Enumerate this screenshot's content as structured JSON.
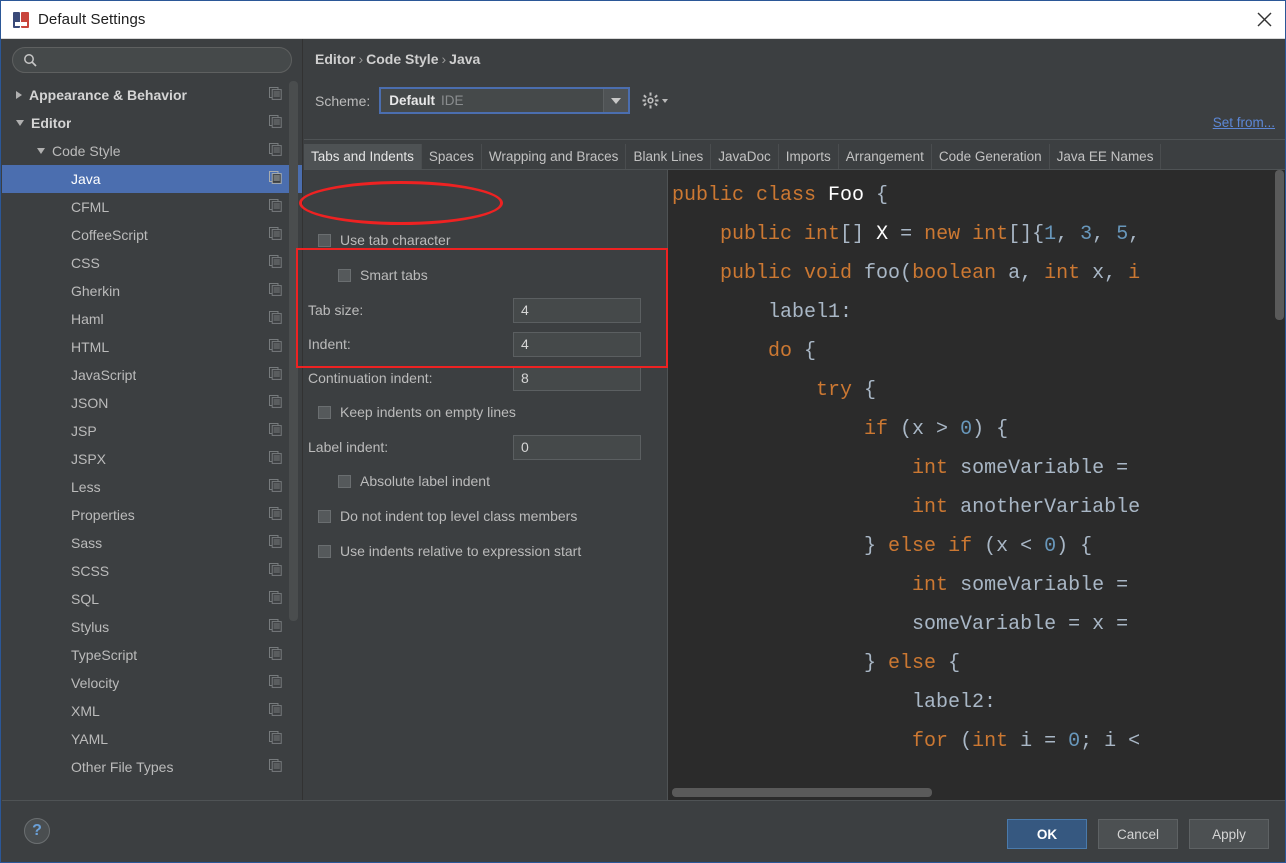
{
  "window": {
    "title": "Default Settings",
    "app_icon": "intellij-idea-icon",
    "close_label": "✕"
  },
  "sidebar": {
    "search": {
      "value": "",
      "placeholder": "",
      "icon": "search-icon"
    },
    "items": [
      {
        "label": "Appearance & Behavior",
        "indent": 0,
        "arrow": "right",
        "bold": true,
        "selected": false,
        "copy_icon": true
      },
      {
        "label": "Editor",
        "indent": 0,
        "arrow": "down",
        "bold": true,
        "selected": false,
        "copy_icon": true
      },
      {
        "label": "Code Style",
        "indent": 1,
        "arrow": "down",
        "bold": false,
        "selected": false,
        "copy_icon": true
      },
      {
        "label": "Java",
        "indent": 2,
        "arrow": "none",
        "bold": false,
        "selected": true,
        "copy_icon": true
      },
      {
        "label": "CFML",
        "indent": 2,
        "arrow": "none",
        "bold": false,
        "selected": false,
        "copy_icon": true
      },
      {
        "label": "CoffeeScript",
        "indent": 2,
        "arrow": "none",
        "bold": false,
        "selected": false,
        "copy_icon": true
      },
      {
        "label": "CSS",
        "indent": 2,
        "arrow": "none",
        "bold": false,
        "selected": false,
        "copy_icon": true
      },
      {
        "label": "Gherkin",
        "indent": 2,
        "arrow": "none",
        "bold": false,
        "selected": false,
        "copy_icon": true
      },
      {
        "label": "Haml",
        "indent": 2,
        "arrow": "none",
        "bold": false,
        "selected": false,
        "copy_icon": true
      },
      {
        "label": "HTML",
        "indent": 2,
        "arrow": "none",
        "bold": false,
        "selected": false,
        "copy_icon": true
      },
      {
        "label": "JavaScript",
        "indent": 2,
        "arrow": "none",
        "bold": false,
        "selected": false,
        "copy_icon": true
      },
      {
        "label": "JSON",
        "indent": 2,
        "arrow": "none",
        "bold": false,
        "selected": false,
        "copy_icon": true
      },
      {
        "label": "JSP",
        "indent": 2,
        "arrow": "none",
        "bold": false,
        "selected": false,
        "copy_icon": true
      },
      {
        "label": "JSPX",
        "indent": 2,
        "arrow": "none",
        "bold": false,
        "selected": false,
        "copy_icon": true
      },
      {
        "label": "Less",
        "indent": 2,
        "arrow": "none",
        "bold": false,
        "selected": false,
        "copy_icon": true
      },
      {
        "label": "Properties",
        "indent": 2,
        "arrow": "none",
        "bold": false,
        "selected": false,
        "copy_icon": true
      },
      {
        "label": "Sass",
        "indent": 2,
        "arrow": "none",
        "bold": false,
        "selected": false,
        "copy_icon": true
      },
      {
        "label": "SCSS",
        "indent": 2,
        "arrow": "none",
        "bold": false,
        "selected": false,
        "copy_icon": true
      },
      {
        "label": "SQL",
        "indent": 2,
        "arrow": "none",
        "bold": false,
        "selected": false,
        "copy_icon": true
      },
      {
        "label": "Stylus",
        "indent": 2,
        "arrow": "none",
        "bold": false,
        "selected": false,
        "copy_icon": true
      },
      {
        "label": "TypeScript",
        "indent": 2,
        "arrow": "none",
        "bold": false,
        "selected": false,
        "copy_icon": true
      },
      {
        "label": "Velocity",
        "indent": 2,
        "arrow": "none",
        "bold": false,
        "selected": false,
        "copy_icon": true
      },
      {
        "label": "XML",
        "indent": 2,
        "arrow": "none",
        "bold": false,
        "selected": false,
        "copy_icon": true
      },
      {
        "label": "YAML",
        "indent": 2,
        "arrow": "none",
        "bold": false,
        "selected": false,
        "copy_icon": true
      },
      {
        "label": "Other File Types",
        "indent": 2,
        "arrow": "none",
        "bold": false,
        "selected": false,
        "copy_icon": true
      }
    ]
  },
  "content": {
    "breadcrumb": {
      "parts": [
        "Editor",
        "Code Style",
        "Java"
      ],
      "separator": "›"
    },
    "scheme": {
      "label": "Scheme:",
      "value": "Default",
      "value_suffix": "IDE",
      "gear_icon": "gear-icon",
      "dropdown_icon": "chevron-down-icon"
    },
    "set_from_link": "Set from...",
    "tabs": [
      {
        "label": "Tabs and Indents",
        "active": true
      },
      {
        "label": "Spaces",
        "active": false
      },
      {
        "label": "Wrapping and Braces",
        "active": false
      },
      {
        "label": "Blank Lines",
        "active": false
      },
      {
        "label": "JavaDoc",
        "active": false
      },
      {
        "label": "Imports",
        "active": false
      },
      {
        "label": "Arrangement",
        "active": false
      },
      {
        "label": "Code Generation",
        "active": false
      },
      {
        "label": "Java EE Names",
        "active": false
      }
    ]
  },
  "settings": {
    "use_tab_character": {
      "label": "Use tab character",
      "checked": false
    },
    "smart_tabs": {
      "label": "Smart tabs",
      "checked": false
    },
    "tab_size": {
      "label": "Tab size:",
      "value": "4"
    },
    "indent": {
      "label": "Indent:",
      "value": "4"
    },
    "continuation_indent": {
      "label": "Continuation indent:",
      "value": "8"
    },
    "keep_indents_on_empty_lines": {
      "label": "Keep indents on empty lines",
      "checked": false
    },
    "label_indent": {
      "label": "Label indent:",
      "value": "0"
    },
    "absolute_label_indent": {
      "label": "Absolute label indent",
      "checked": false
    },
    "do_not_indent_top_level": {
      "label": "Do not indent top level class members",
      "checked": false
    },
    "use_indents_relative": {
      "label": "Use indents relative to expression start",
      "checked": false
    }
  },
  "preview": {
    "lines": [
      [
        [
          "k",
          "public "
        ],
        [
          "k",
          "class "
        ],
        [
          "w",
          "Foo "
        ],
        [
          "p",
          "{"
        ]
      ],
      [
        [
          "dots",
          "    "
        ],
        [
          "k",
          "public "
        ],
        [
          "k",
          "int"
        ],
        [
          "p",
          "[] "
        ],
        [
          "w",
          "X "
        ],
        [
          "p",
          "= "
        ],
        [
          "k",
          "new "
        ],
        [
          "k",
          "int"
        ],
        [
          "p",
          "[]{"
        ],
        [
          "n",
          "1"
        ],
        [
          "p",
          ", "
        ],
        [
          "n",
          "3"
        ],
        [
          "p",
          ", "
        ],
        [
          "n",
          "5"
        ],
        [
          "p",
          ","
        ]
      ],
      [
        [
          "p",
          ""
        ]
      ],
      [
        [
          "dots",
          "    "
        ],
        [
          "k",
          "public "
        ],
        [
          "k",
          "void "
        ],
        [
          "p",
          "foo("
        ],
        [
          "k",
          "boolean "
        ],
        [
          "p",
          "a, "
        ],
        [
          "k",
          "int "
        ],
        [
          "p",
          "x, "
        ],
        [
          "k",
          "i"
        ]
      ],
      [
        [
          "dots",
          "        "
        ],
        [
          "p",
          "label1:"
        ]
      ],
      [
        [
          "dots",
          "        "
        ],
        [
          "k",
          "do "
        ],
        [
          "p",
          "{"
        ]
      ],
      [
        [
          "dots",
          "            "
        ],
        [
          "k",
          "try "
        ],
        [
          "p",
          "{"
        ]
      ],
      [
        [
          "dots",
          "                "
        ],
        [
          "k",
          "if "
        ],
        [
          "p",
          "(x > "
        ],
        [
          "n",
          "0"
        ],
        [
          "p",
          ") {"
        ]
      ],
      [
        [
          "dots",
          "                    "
        ],
        [
          "k",
          "int "
        ],
        [
          "p",
          "someVariable = "
        ]
      ],
      [
        [
          "dots",
          "                    "
        ],
        [
          "k",
          "int "
        ],
        [
          "p",
          "anotherVariable"
        ]
      ],
      [
        [
          "dots",
          "                "
        ],
        [
          "p",
          "} "
        ],
        [
          "k",
          "else "
        ],
        [
          "k",
          "if "
        ],
        [
          "p",
          "(x < "
        ],
        [
          "n",
          "0"
        ],
        [
          "p",
          ") {"
        ]
      ],
      [
        [
          "dots",
          "                    "
        ],
        [
          "k",
          "int "
        ],
        [
          "p",
          "someVariable = "
        ]
      ],
      [
        [
          "dots",
          "                    "
        ],
        [
          "p",
          "someVariable = x = "
        ]
      ],
      [
        [
          "dots",
          "                "
        ],
        [
          "p",
          "} "
        ],
        [
          "k",
          "else "
        ],
        [
          "p",
          "{"
        ]
      ],
      [
        [
          "dots",
          "                    "
        ],
        [
          "p",
          "label2:"
        ]
      ],
      [
        [
          "dots",
          "                    "
        ],
        [
          "k",
          "for "
        ],
        [
          "p",
          "("
        ],
        [
          "k",
          "int "
        ],
        [
          "p",
          "i = "
        ],
        [
          "n",
          "0"
        ],
        [
          "p",
          "; i <"
        ]
      ]
    ]
  },
  "footer": {
    "help_label": "?",
    "ok_label": "OK",
    "cancel_label": "Cancel",
    "apply_label": "Apply"
  },
  "annotations": {
    "color": "#ee2222",
    "ellipse_target": "use-tab-character-checkbox",
    "rect_target": "indent-fields-group"
  }
}
